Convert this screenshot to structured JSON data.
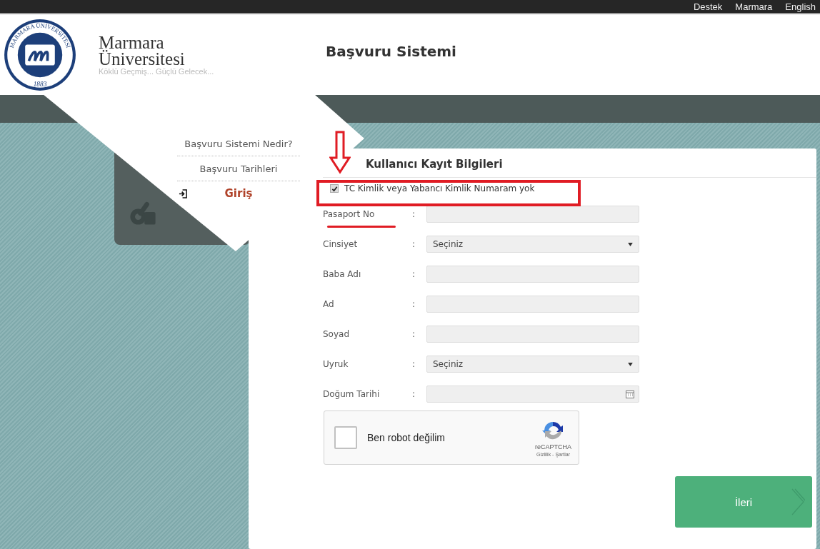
{
  "top_links": [
    {
      "label": "Destek"
    },
    {
      "label": "Marmara"
    },
    {
      "label": "English"
    }
  ],
  "header": {
    "logo_ring": "MARMARA ÜNİVERSİTESİ",
    "logo_year": "1883",
    "name_lines": [
      "Marmara",
      "Üniversitesi"
    ],
    "slogan": "Köklü Geçmiş... Güçlü Gelecek...",
    "system_title": "Başvuru Sistemi"
  },
  "menu": [
    {
      "label": "Başvuru Sistemi Nedir?",
      "selected": false
    },
    {
      "label": "Başvuru Tarihleri",
      "selected": false
    },
    {
      "label": "Giriş",
      "selected": true
    }
  ],
  "form": {
    "title": "Kullanıcı Kayıt Bilgileri",
    "no_id": {
      "label": "TC Kimlik veya Yabancı Kimlik Numaram yok",
      "checked": true
    },
    "fields": [
      {
        "kind": "text",
        "label": "Pasaport No"
      },
      {
        "kind": "select",
        "label": "Cinsiyet",
        "value": "Seçiniz"
      },
      {
        "kind": "text",
        "label": "Baba Adı"
      },
      {
        "kind": "text",
        "label": "Ad"
      },
      {
        "kind": "text",
        "label": "Soyad"
      },
      {
        "kind": "select",
        "label": "Uyruk",
        "value": "Seçiniz"
      },
      {
        "kind": "date",
        "label": "Doğum Tarihi"
      }
    ],
    "separator": ":",
    "captcha": {
      "label": "Ben robot değilim",
      "checked": false,
      "brand": "reCAPTCHA",
      "links": "Gizlilik - Şartlar"
    },
    "next_button": "İleri"
  }
}
